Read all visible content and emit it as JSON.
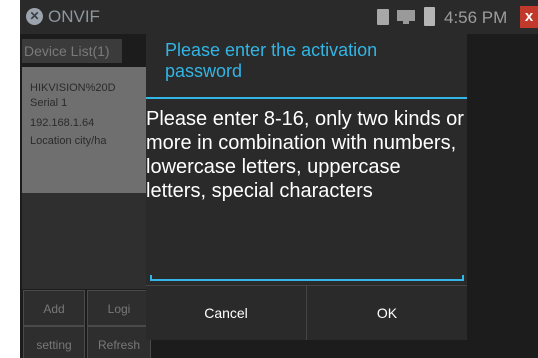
{
  "status_bar": {
    "app_title": "ONVIF",
    "time": "4:56 PM",
    "icons": [
      "onvif-app-icon",
      "sd-card-icon",
      "network-icon",
      "battery-icon",
      "close-icon"
    ],
    "close_glyph": "x"
  },
  "background": {
    "device_list_header": "Device List(1)",
    "device": {
      "name": "HIKVISION%20D",
      "serial": "Serial 1",
      "ip": "192.168.1.64",
      "location": "Location city/ha"
    },
    "buttons": {
      "add": "Add",
      "login": "Logi",
      "setting": "setting",
      "refresh": "Refresh"
    }
  },
  "dialog": {
    "title": "Please enter the activation password",
    "message": "Please enter 8-16, only two kinds or more in combination with numbers, lowercase letters, uppercase letters, special characters",
    "input_value": "",
    "cancel_label": "Cancel",
    "ok_label": "OK"
  },
  "colors": {
    "accent": "#33b5e5",
    "dialog_bg": "#2a2a2a",
    "close_red": "#c0392b"
  }
}
